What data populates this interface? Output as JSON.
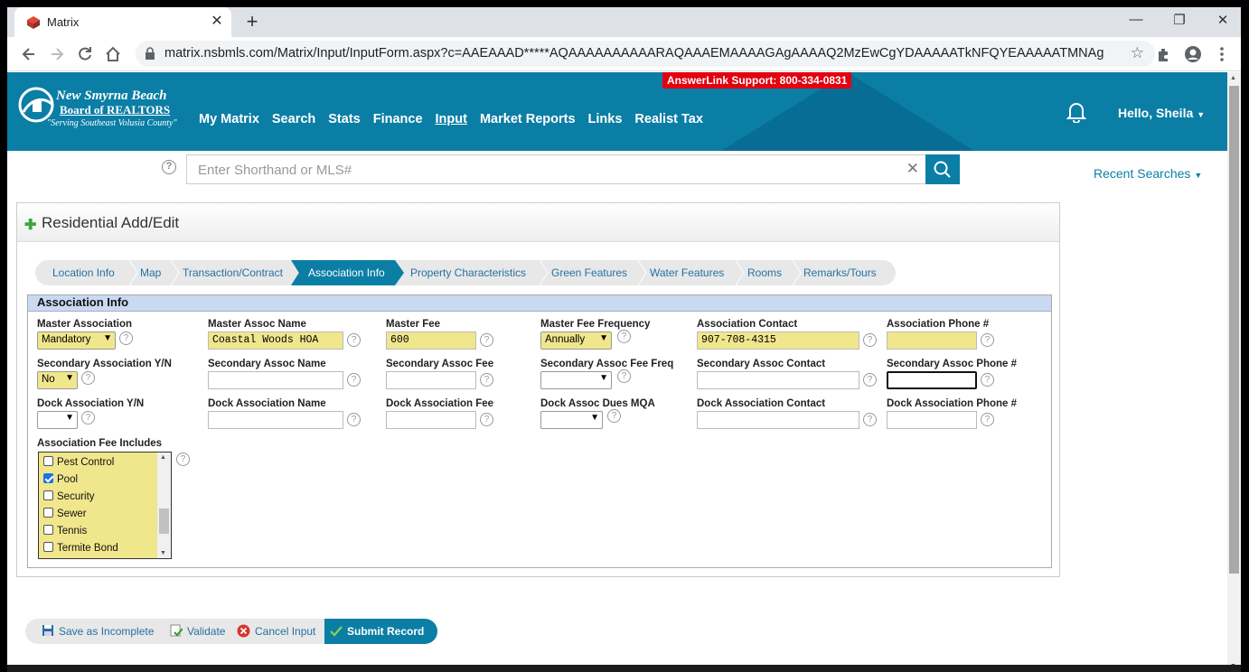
{
  "browser": {
    "tab_title": "Matrix",
    "url": "matrix.nsbmls.com/Matrix/Input/InputForm.aspx?c=AAEAAAD*****AQAAAAAAAAAARAQAAAEMAAAAGAgAAAAQ2MzEwCgYDAAAAATkNFQYEAAAAATMNAgYFAAAAj..."
  },
  "header": {
    "logo_line1": "New Smyrna Beach",
    "logo_line2": "Board of REALTORS",
    "logo_line3": "\"Serving Southeast Volusia County\"",
    "support": "AnswerLink Support: 800-334-0831",
    "nav": [
      "My Matrix",
      "Search",
      "Stats",
      "Finance",
      "Input",
      "Market Reports",
      "Links",
      "Realist Tax"
    ],
    "active_nav": "Input",
    "greeting": "Hello, Sheila"
  },
  "search": {
    "placeholder": "Enter Shorthand or MLS#",
    "recent": "Recent Searches"
  },
  "form": {
    "title": "Residential Add/Edit",
    "steps": [
      "Location Info",
      "Map",
      "Transaction/Contract",
      "Association Info",
      "Property Characteristics",
      "Green Features",
      "Water Features",
      "Rooms",
      "Remarks/Tours"
    ],
    "active_step": "Association Info",
    "section_title": "Association Info",
    "fields": {
      "master_association": {
        "label": "Master Association",
        "value": "Mandatory"
      },
      "master_assoc_name": {
        "label": "Master Assoc Name",
        "value": "Coastal Woods HOA"
      },
      "master_fee": {
        "label": "Master Fee",
        "value": "600"
      },
      "master_fee_frequency": {
        "label": "Master Fee Frequency",
        "value": "Annually"
      },
      "association_contact": {
        "label": "Association Contact",
        "value": "907-708-4315"
      },
      "association_phone": {
        "label": "Association Phone #",
        "value": ""
      },
      "secondary_association_yn": {
        "label": "Secondary Association Y/N",
        "value": "No"
      },
      "secondary_assoc_name": {
        "label": "Secondary Assoc Name",
        "value": ""
      },
      "secondary_assoc_fee": {
        "label": "Secondary Assoc Fee",
        "value": ""
      },
      "secondary_assoc_fee_freq": {
        "label": "Secondary Assoc Fee Freq",
        "value": ""
      },
      "secondary_assoc_contact": {
        "label": "Secondary Assoc Contact",
        "value": ""
      },
      "secondary_assoc_phone": {
        "label": "Secondary Assoc Phone #",
        "value": ""
      },
      "dock_association_yn": {
        "label": "Dock Association Y/N",
        "value": ""
      },
      "dock_association_name": {
        "label": "Dock Association Name",
        "value": ""
      },
      "dock_association_fee": {
        "label": "Dock Association Fee",
        "value": ""
      },
      "dock_assoc_dues_mqa": {
        "label": "Dock Assoc Dues MQA",
        "value": ""
      },
      "dock_association_contact": {
        "label": "Dock Association Contact",
        "value": ""
      },
      "dock_association_phone": {
        "label": "Dock Association Phone #",
        "value": ""
      }
    },
    "fee_includes_label": "Association Fee Includes",
    "fee_includes": [
      {
        "label": "Pest Control",
        "checked": false
      },
      {
        "label": "Pool",
        "checked": true
      },
      {
        "label": "Security",
        "checked": false
      },
      {
        "label": "Sewer",
        "checked": false
      },
      {
        "label": "Tennis",
        "checked": false
      },
      {
        "label": "Termite Bond",
        "checked": false
      }
    ]
  },
  "actions": {
    "save": "Save as Incomplete",
    "validate": "Validate",
    "cancel": "Cancel Input",
    "submit": "Submit Record"
  }
}
